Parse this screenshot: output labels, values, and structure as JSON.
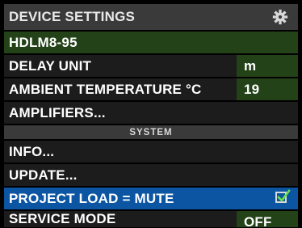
{
  "title": "DEVICE SETTINGS",
  "icons": {
    "settings": "gear-icon",
    "checkbox": "checkbox-checked-icon"
  },
  "colors": {
    "title_bar": "#3a3a3a",
    "value_bg": "#234218",
    "row_bg": "#1c1c1c",
    "selected": "#0b55a3",
    "check": "#6ee04a"
  },
  "device_name": "HDLM8-95",
  "settings": {
    "delay_unit": {
      "label": "DELAY UNIT",
      "value": "m"
    },
    "ambient_temperature": {
      "label": "AMBIENT TEMPERATURE °C",
      "value": "19"
    },
    "amplifiers": {
      "label": "AMPLIFIERS..."
    }
  },
  "system": {
    "header": "SYSTEM",
    "info": "INFO...",
    "update": "UPDATE...",
    "project_load": {
      "label": "PROJECT LOAD = MUTE",
      "checked": true
    },
    "service_mode": {
      "label": "SERVICE MODE",
      "value": "OFF"
    }
  }
}
